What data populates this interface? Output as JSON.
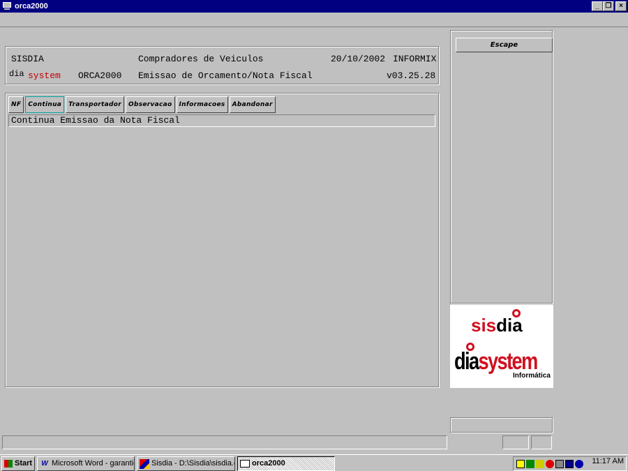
{
  "window": {
    "title": "orca2000",
    "minimize": "_",
    "maximize": "❐",
    "close": "×"
  },
  "header": {
    "company": "SISDIA",
    "title": "Compradores de Veiculos",
    "date": "20/10/2002",
    "db": "INFORMIX",
    "brand_dia": "dia",
    "brand_system": "system",
    "program": "ORCA2000",
    "subtitle": "Emissao de Orcamento/Nota Fiscal",
    "version": "v03.25.28"
  },
  "menu": {
    "items": [
      {
        "label": "NF"
      },
      {
        "label": "Continua"
      },
      {
        "label": "Transportador"
      },
      {
        "label": "Observacao"
      },
      {
        "label": "Informacoes"
      },
      {
        "label": "Abandonar"
      }
    ],
    "active_index": 1,
    "description": "Continua Emissao da Nota Fiscal"
  },
  "side": {
    "escape_label": "Escape"
  },
  "logo": {
    "sis": "sis",
    "dia": "dia",
    "dia2": "dia",
    "system": "system",
    "informatica": "Informática"
  },
  "taskbar": {
    "start": "Start",
    "tasks": [
      {
        "label": "Microsoft Word - garantiee...",
        "icon": "word-icon"
      },
      {
        "label": "Sisdia - D:\\Sisdia\\sisdia.cmd",
        "icon": "sisdia-icon"
      },
      {
        "label": "orca2000",
        "icon": "terminal-icon",
        "active": true
      }
    ],
    "clock": "11:17 AM"
  },
  "colors": {
    "titlebar": "#000080",
    "accent_red": "#d01020",
    "face": "#c0c0c0"
  }
}
